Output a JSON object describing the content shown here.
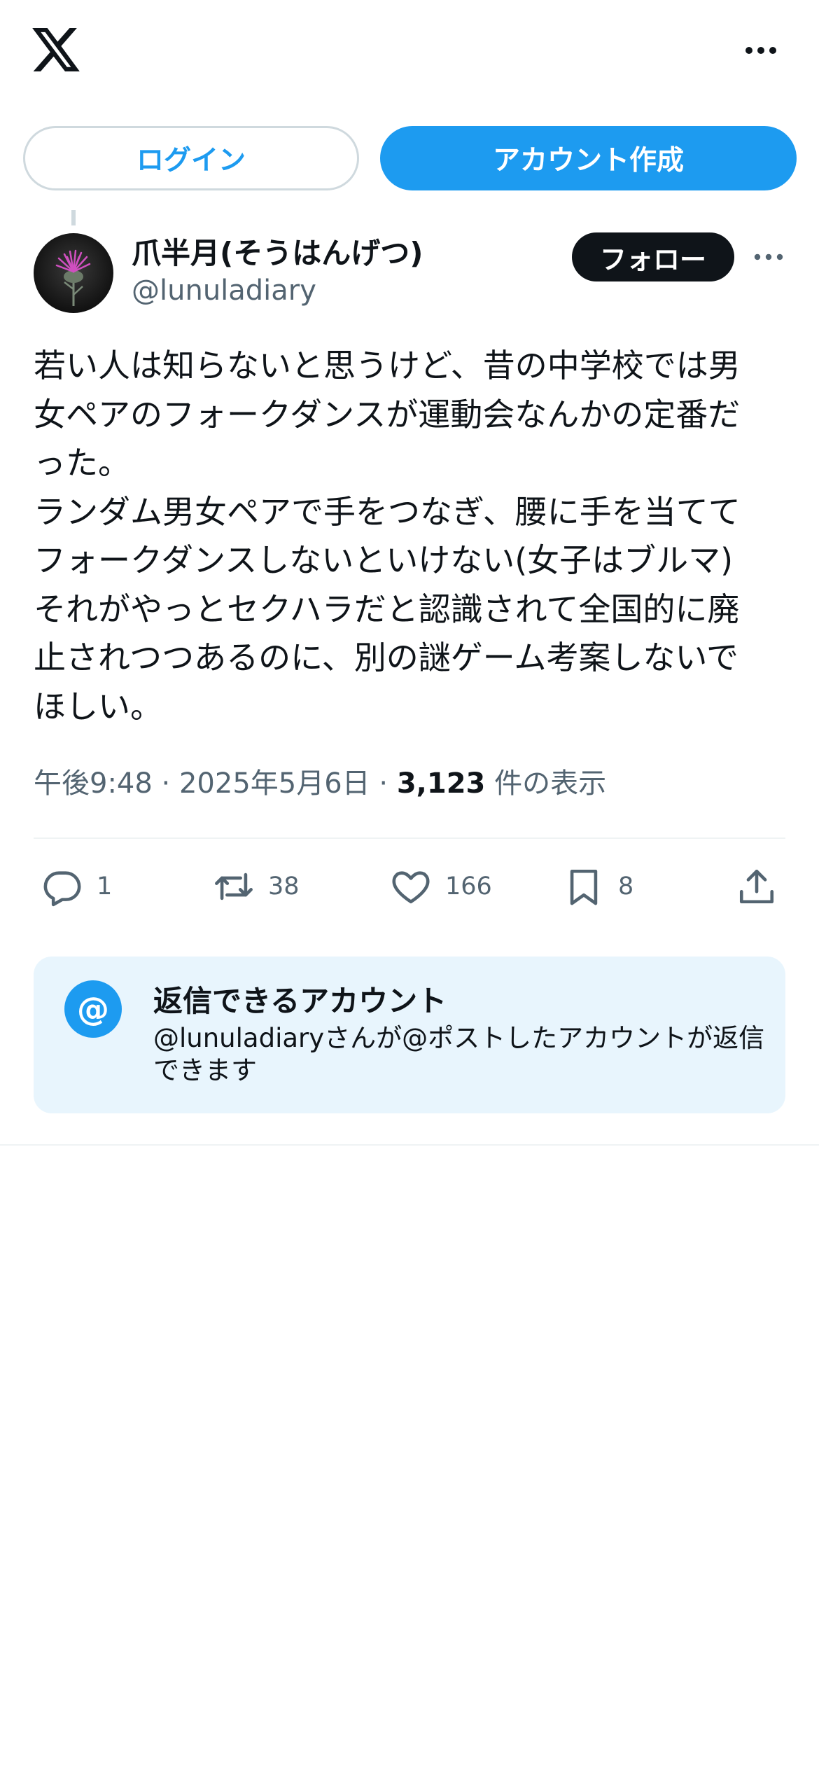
{
  "header": {
    "logo_icon": "x-logo-icon",
    "more_icon": "more-horizontal-icon"
  },
  "auth": {
    "login_label": "ログイン",
    "signup_label": "アカウント作成"
  },
  "post": {
    "author": {
      "display_name": "爪半月(そうはんげつ)",
      "handle": "@lunuladiary",
      "avatar_description": "purple thistle flower on dark background"
    },
    "follow_label": "フォロー",
    "text": "若い人は知らないと思うけど、昔の中学校では男\n女ペアのフォークダンスが運動会なんかの定番だ\nった。\nランダム男女ペアで手をつなぎ、腰に手を当てて\nフォークダンスしないといけない(女子はブルマ)\nそれがやっとセクハラだと認識されて全国的に廃\n止されつつあるのに、別の謎ゲーム考案しないで\nほしい。",
    "time": "午後9:48",
    "date": "2025年5月6日",
    "separator": "·",
    "views_count": "3,123",
    "views_label": "件の表示",
    "actions": {
      "replies": "1",
      "reposts": "38",
      "likes": "166",
      "bookmarks": "8"
    }
  },
  "reply_restriction": {
    "icon": "@",
    "title": "返信できるアカウント",
    "description": "@lunuladiaryさんが@ポストしたアカウントが返信できます"
  },
  "colors": {
    "accent": "#1d9bf0",
    "text": "#0f1419",
    "secondary": "#536471",
    "reply_box_bg": "#e8f5fd"
  }
}
